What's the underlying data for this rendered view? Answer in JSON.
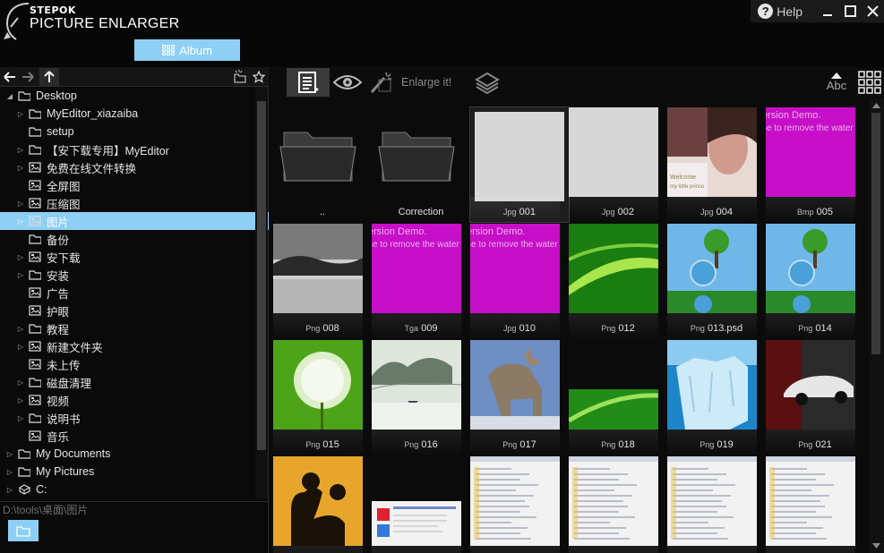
{
  "app": {
    "logo_top": "STEPOK",
    "logo_main": "PICTURE ENLARGER",
    "album_label": "Album",
    "help_label": "Help"
  },
  "toolbar": {
    "enlarge_label": "Enlarge it!",
    "sort_label": "Abc"
  },
  "tree": {
    "items": [
      {
        "label": "Desktop",
        "level": 0,
        "expanded": true,
        "icon": "folder-icon"
      },
      {
        "label": "MyEditor_xiazaiba",
        "level": 1,
        "arrow": true,
        "icon": "folder-icon"
      },
      {
        "label": "setup",
        "level": 1,
        "arrow": false,
        "icon": "folder-icon"
      },
      {
        "label": "【安下载专用】MyEditor",
        "level": 1,
        "arrow": true,
        "icon": "folder-icon"
      },
      {
        "label": "免费在线文件转换",
        "level": 1,
        "arrow": true,
        "icon": "image-folder-icon"
      },
      {
        "label": "全屏图",
        "level": 1,
        "arrow": false,
        "icon": "image-folder-icon"
      },
      {
        "label": "压缩图",
        "level": 1,
        "arrow": true,
        "icon": "image-folder-icon"
      },
      {
        "label": "图片",
        "level": 1,
        "arrow": true,
        "icon": "image-folder-icon",
        "selected": true
      },
      {
        "label": "备份",
        "level": 1,
        "arrow": false,
        "icon": "folder-icon"
      },
      {
        "label": "安下载",
        "level": 1,
        "arrow": true,
        "icon": "image-folder-icon"
      },
      {
        "label": "安装",
        "level": 1,
        "arrow": true,
        "icon": "folder-icon"
      },
      {
        "label": "广告",
        "level": 1,
        "arrow": false,
        "icon": "image-folder-icon"
      },
      {
        "label": "护眼",
        "level": 1,
        "arrow": false,
        "icon": "image-folder-icon"
      },
      {
        "label": "教程",
        "level": 1,
        "arrow": true,
        "icon": "folder-icon"
      },
      {
        "label": "新建文件夹",
        "level": 1,
        "arrow": true,
        "icon": "image-folder-icon"
      },
      {
        "label": "未上传",
        "level": 1,
        "arrow": false,
        "icon": "image-folder-icon"
      },
      {
        "label": "磁盘清理",
        "level": 1,
        "arrow": true,
        "icon": "folder-icon"
      },
      {
        "label": "视频",
        "level": 1,
        "arrow": true,
        "icon": "image-folder-icon"
      },
      {
        "label": "说明书",
        "level": 1,
        "arrow": true,
        "icon": "folder-icon"
      },
      {
        "label": "音乐",
        "level": 1,
        "arrow": false,
        "icon": "image-folder-icon"
      },
      {
        "label": "My Documents",
        "level": 0,
        "arrow": true,
        "icon": "folder-icon"
      },
      {
        "label": "My Pictures",
        "level": 0,
        "arrow": true,
        "icon": "folder-icon"
      },
      {
        "label": "C:",
        "level": 0,
        "arrow": true,
        "icon": "drive-icon"
      }
    ]
  },
  "path": "D:\\tools\\桌面\\图片",
  "tiles": [
    {
      "fmt": "",
      "name": "..",
      "kind": "folder"
    },
    {
      "fmt": "",
      "name": "Correction",
      "kind": "folder"
    },
    {
      "fmt": "Jpg",
      "name": "001",
      "kind": "blank",
      "selected": true
    },
    {
      "fmt": "Jpg",
      "name": "002",
      "kind": "blank"
    },
    {
      "fmt": "Jpg",
      "name": "004",
      "kind": "portrait"
    },
    {
      "fmt": "Bmp",
      "name": "005",
      "kind": "magenta"
    },
    {
      "fmt": "Png",
      "name": "008",
      "kind": "bw"
    },
    {
      "fmt": "Tga",
      "name": "009",
      "kind": "magenta"
    },
    {
      "fmt": "Jpg",
      "name": "010",
      "kind": "magenta"
    },
    {
      "fmt": "Png",
      "name": "012",
      "kind": "green"
    },
    {
      "fmt": "Png",
      "name": "013.psd",
      "kind": "tree"
    },
    {
      "fmt": "Png",
      "name": "014",
      "kind": "tree"
    },
    {
      "fmt": "Png",
      "name": "015",
      "kind": "dandelion"
    },
    {
      "fmt": "Png",
      "name": "016",
      "kind": "landscape"
    },
    {
      "fmt": "Png",
      "name": "017",
      "kind": "wolf"
    },
    {
      "fmt": "Png",
      "name": "018",
      "kind": "green-small"
    },
    {
      "fmt": "Png",
      "name": "019",
      "kind": "iceberg"
    },
    {
      "fmt": "Png",
      "name": "021",
      "kind": "car"
    },
    {
      "fmt": "",
      "name": "",
      "kind": "sunset"
    },
    {
      "fmt": "",
      "name": "",
      "kind": "screenshot-red"
    },
    {
      "fmt": "",
      "name": "",
      "kind": "screenshot"
    },
    {
      "fmt": "",
      "name": "",
      "kind": "screenshot"
    },
    {
      "fmt": "",
      "name": "",
      "kind": "screenshot"
    },
    {
      "fmt": "",
      "name": "",
      "kind": "screenshot"
    }
  ],
  "colors": {
    "accent": "#8ecff5",
    "background": "#0c0c0c",
    "magenta": "#c80fc8"
  }
}
